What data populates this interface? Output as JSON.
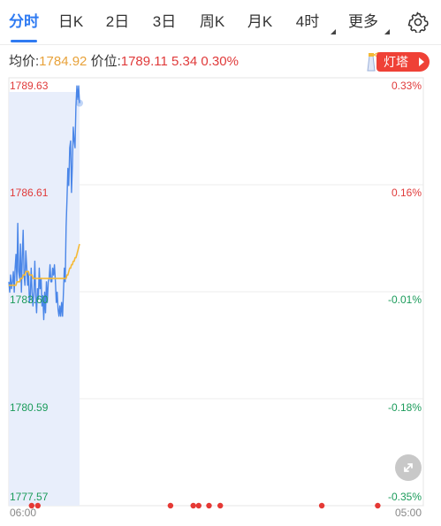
{
  "tabs": [
    {
      "label": "分时",
      "active": true
    },
    {
      "label": "日K"
    },
    {
      "label": "2日"
    },
    {
      "label": "3日"
    },
    {
      "label": "周K"
    },
    {
      "label": "月K"
    },
    {
      "label": "4时"
    },
    {
      "label": "更多"
    }
  ],
  "info": {
    "avg_label": "均价:",
    "avg_value": "1784.92",
    "price_label": "价位:",
    "price_value": "1789.11",
    "change": "5.34",
    "change_pct": "0.30%"
  },
  "lamp": {
    "label": "灯塔"
  },
  "colors": {
    "accent": "#2f7bf2",
    "up": "#e03a3a",
    "down": "#1a9b5a",
    "avg_line": "#f5b935",
    "price_line": "#4a86e8",
    "area": "#e8eefb"
  },
  "chart_data": {
    "type": "line",
    "y_left_ticks": [
      "1789.63",
      "1786.61",
      "1783.60",
      "1780.59",
      "1777.57"
    ],
    "y_right_ticks": [
      "0.33%",
      "0.16%",
      "-0.01%",
      "-0.18%",
      "-0.35%"
    ],
    "x_ticks": [
      "06:00",
      "05:00"
    ],
    "ylim": [
      1777.57,
      1789.63
    ],
    "prev_close": 1783.77,
    "series": [
      {
        "role": "price",
        "values": [
          1783.9,
          1783.6,
          1784.1,
          1783.7,
          1783.9,
          1784.2,
          1783.6,
          1784.3,
          1784.7,
          1783.9,
          1785.6,
          1784.2,
          1784.0,
          1785.0,
          1783.6,
          1784.6,
          1785.4,
          1784.1,
          1783.8,
          1784.8,
          1784.3,
          1783.8,
          1784.2,
          1783.3,
          1783.5,
          1784.3,
          1783.6,
          1783.2,
          1783.6,
          1784.5,
          1783.5,
          1783.0,
          1783.7,
          1783.4,
          1784.3,
          1783.7,
          1784.0,
          1783.2,
          1783.5,
          1782.8,
          1783.6,
          1783.0,
          1783.9,
          1783.3,
          1783.9,
          1784.0,
          1784.4,
          1783.9,
          1783.9,
          1784.3,
          1784.1,
          1784.4,
          1783.9,
          1783.3,
          1783.6,
          1783.1,
          1782.9,
          1783.2,
          1782.9,
          1783.3,
          1782.9,
          1783.6,
          1784.3,
          1783.9,
          1785.5,
          1786.3,
          1787.2,
          1786.7,
          1787.8,
          1788.0,
          1786.5,
          1787.3,
          1788.4,
          1788.0,
          1787.8,
          1789.0,
          1789.6,
          1789.2,
          1789.6,
          1789.1
        ],
        "color": "#4a86e8"
      },
      {
        "role": "avg",
        "values": [
          1783.8,
          1783.8,
          1783.8,
          1783.8,
          1783.8,
          1783.8,
          1783.8,
          1783.8,
          1783.8,
          1783.9,
          1783.9,
          1783.9,
          1783.9,
          1784.0,
          1784.0,
          1784.0,
          1784.1,
          1784.1,
          1784.1,
          1784.2,
          1784.2,
          1784.2,
          1784.2,
          1784.1,
          1784.1,
          1784.1,
          1784.1,
          1784.0,
          1784.0,
          1784.0,
          1784.0,
          1784.0,
          1784.0,
          1784.0,
          1784.0,
          1784.0,
          1784.0,
          1784.0,
          1784.0,
          1784.0,
          1784.0,
          1784.0,
          1784.0,
          1784.0,
          1784.0,
          1784.0,
          1784.0,
          1784.0,
          1784.0,
          1784.0,
          1784.0,
          1784.0,
          1784.0,
          1784.0,
          1784.0,
          1784.0,
          1784.0,
          1784.0,
          1784.0,
          1784.0,
          1784.0,
          1784.0,
          1784.0,
          1784.0,
          1784.0,
          1784.1,
          1784.1,
          1784.2,
          1784.3,
          1784.3,
          1784.4,
          1784.4,
          1784.5,
          1784.5,
          1784.6,
          1784.6,
          1784.7,
          1784.8,
          1784.9,
          1785.0
        ],
        "color": "#f5b935"
      }
    ],
    "event_dots": [
      0.055,
      0.07,
      0.39,
      0.445,
      0.458,
      0.483,
      0.51,
      0.755,
      0.89
    ]
  }
}
